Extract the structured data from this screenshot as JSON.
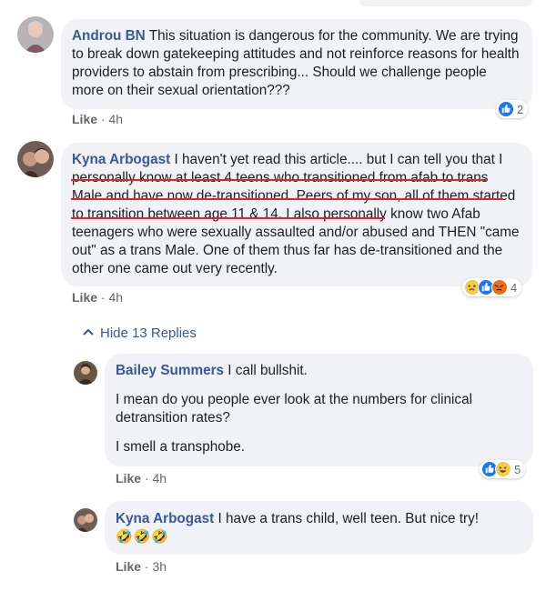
{
  "comments": [
    {
      "author": "Androu BN",
      "text": "This situation is dangerous for the community. We are trying to break down gatekeeping attitudes and not reinforce reasons for health providers to abstain from prescribing... Should we challenge people more on their sexual orientation???",
      "like_label": "Like",
      "time": "4h",
      "reaction_count": "2",
      "reactions": [
        "like-icon"
      ]
    },
    {
      "author": "Kyna Arbogast",
      "text": "I haven't yet read this article.... but I can tell you that I personally know at least 4 teens who transitioned from afab to trans Male and have now de-transitioned. Peers of my son, all of them started to transition between age 11 & 14. I also personally know two Afab teenagers who were sexually assaulted and/or abused and THEN \"came out\" as a trans Male. One of them thus far has de-transitioned and the other one came out very recently.",
      "like_label": "Like",
      "time": "4h",
      "reaction_count": "4",
      "reactions": [
        "sad-icon",
        "like-icon",
        "angry-icon"
      ]
    }
  ],
  "hide_replies_label": "Hide 13 Replies",
  "replies": [
    {
      "author": "Bailey Summers",
      "paragraphs": [
        "I call bullshit.",
        "I mean do you people ever look at the numbers for clinical detransition rates?",
        "I smell a transphobe."
      ],
      "like_label": "Like",
      "time": "4h",
      "reaction_count": "5",
      "reactions": [
        "like-icon",
        "haha-icon"
      ]
    },
    {
      "author": "Kyna Arbogast",
      "text": "I have a trans child, well teen. But nice try!",
      "emoji": "🤣🤣🤣",
      "like_label": "Like",
      "time": "3h"
    }
  ],
  "colors": {
    "author": "#385898",
    "bubble": "#f0f2f5",
    "underline": "#e0242c",
    "like_blue": "#1877f2"
  }
}
